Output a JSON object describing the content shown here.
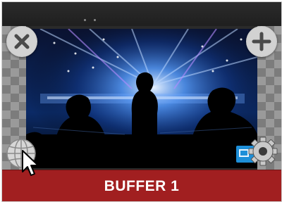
{
  "source": {
    "label": "BUFFER 1",
    "label_bar_color": "#a11f20"
  },
  "controls": {
    "close_icon": "close-icon",
    "add_icon": "plus-icon",
    "input_type_icon": "globe-icon",
    "settings_icon": "gear-icon",
    "output_indicator_icon": "output-indicator-icon"
  },
  "preview": {
    "content": "concert-stage-image"
  }
}
